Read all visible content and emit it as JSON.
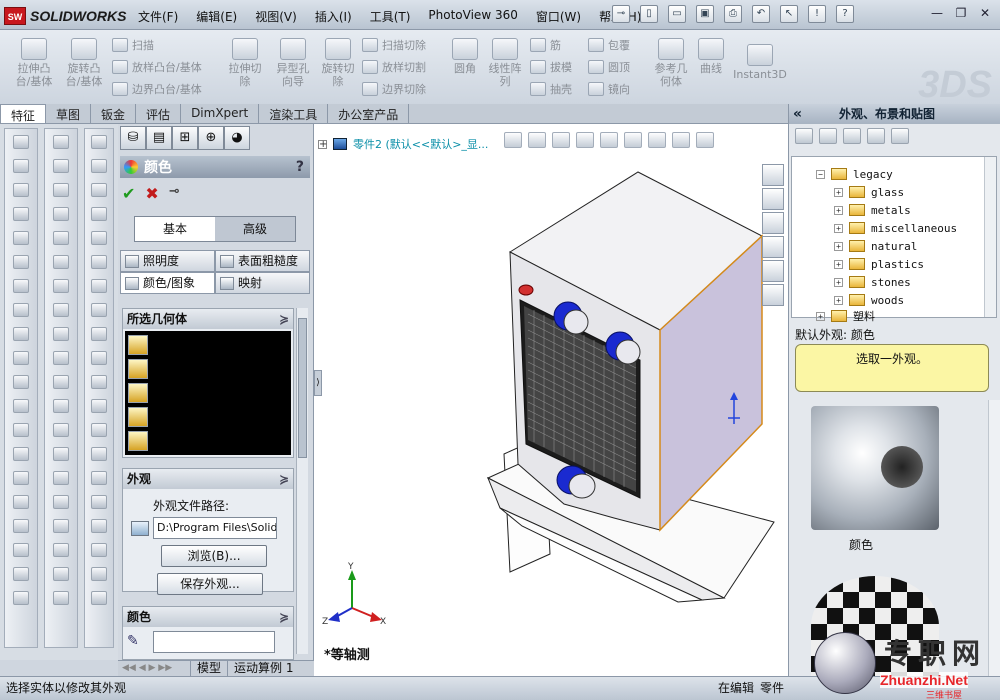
{
  "app": {
    "logo_abbr": "SW",
    "logo_name": "SOLIDWORKS"
  },
  "menu": [
    "文件(F)",
    "编辑(E)",
    "视图(V)",
    "插入(I)",
    "工具(T)",
    "PhotoView 360",
    "窗口(W)",
    "帮助(H)"
  ],
  "commands": {
    "extrude_boss": "拉伸凸\n台/基体",
    "revolve_boss": "旋转凸\n台/基体",
    "sweep": "扫描",
    "loft_boss": "放样凸台/基体",
    "boundary_boss": "边界凸台/基体",
    "extrude_cut": "拉伸切\n除",
    "hole_wizard": "异型孔\n向导",
    "revolve_cut": "旋转切\n除",
    "sweep_cut": "扫描切除",
    "loft_cut": "放样切割",
    "boundary_cut": "边界切除",
    "fillet": "圆角",
    "linear_pattern": "线性阵\n列",
    "rib": "筋",
    "draft": "拔模",
    "shell": "抽壳",
    "wrap": "包覆",
    "dome": "圆顶",
    "mirror": "镜向",
    "ref_geometry": "参考几\n何体",
    "curves": "曲线",
    "instant3d": "Instant3D"
  },
  "tabs": [
    "特征",
    "草图",
    "钣金",
    "评估",
    "DimXpert",
    "渲染工具",
    "办公室产品"
  ],
  "active_tab": "特征",
  "property_manager": {
    "title": "颜色",
    "help": "?",
    "mode_basic": "基本",
    "mode_advanced": "高级",
    "tab_lighting": "照明度",
    "tab_roughness": "表面粗糙度",
    "tab_color_image": "颜色/图象",
    "tab_mapping": "映射",
    "group_selected_geometry": "所选几何体",
    "group_appearance": "外观",
    "appearance_path_label": "外观文件路径:",
    "appearance_path_value": "D:\\Program Files\\SolidWo",
    "browse_button": "浏览(B)...",
    "save_appearance_button": "保存外观...",
    "group_color": "颜色"
  },
  "bottom_tabs": [
    "模型",
    "运动算例 1"
  ],
  "viewport": {
    "tree_label": "零件2  (默认<<默认>_显...",
    "view_name": "*等轴测"
  },
  "task_pane": {
    "title": "外观、布景和贴图",
    "tree": [
      "legacy",
      "glass",
      "metals",
      "miscellaneous",
      "natural",
      "plastics",
      "stones",
      "woods",
      "塑料"
    ],
    "default_appearance": "默认外观: 颜色",
    "tip": "选取一外观。",
    "swatch_caption": "颜色"
  },
  "status": {
    "hint": "选择实体以修改其外观",
    "editing": "在编辑",
    "doc": "零件"
  },
  "watermark": {
    "site": "Zhuanzhi.Net",
    "cn": "专职网",
    "sub": "三维书屋"
  },
  "colors": {
    "accent": "#c8171e",
    "titlebar": "#b9c4d1",
    "viewport_bg": "#ffffff",
    "part_body": "#e6e6ea",
    "part_side": "#c9c2dc",
    "fittings": "#1a2ad0"
  }
}
